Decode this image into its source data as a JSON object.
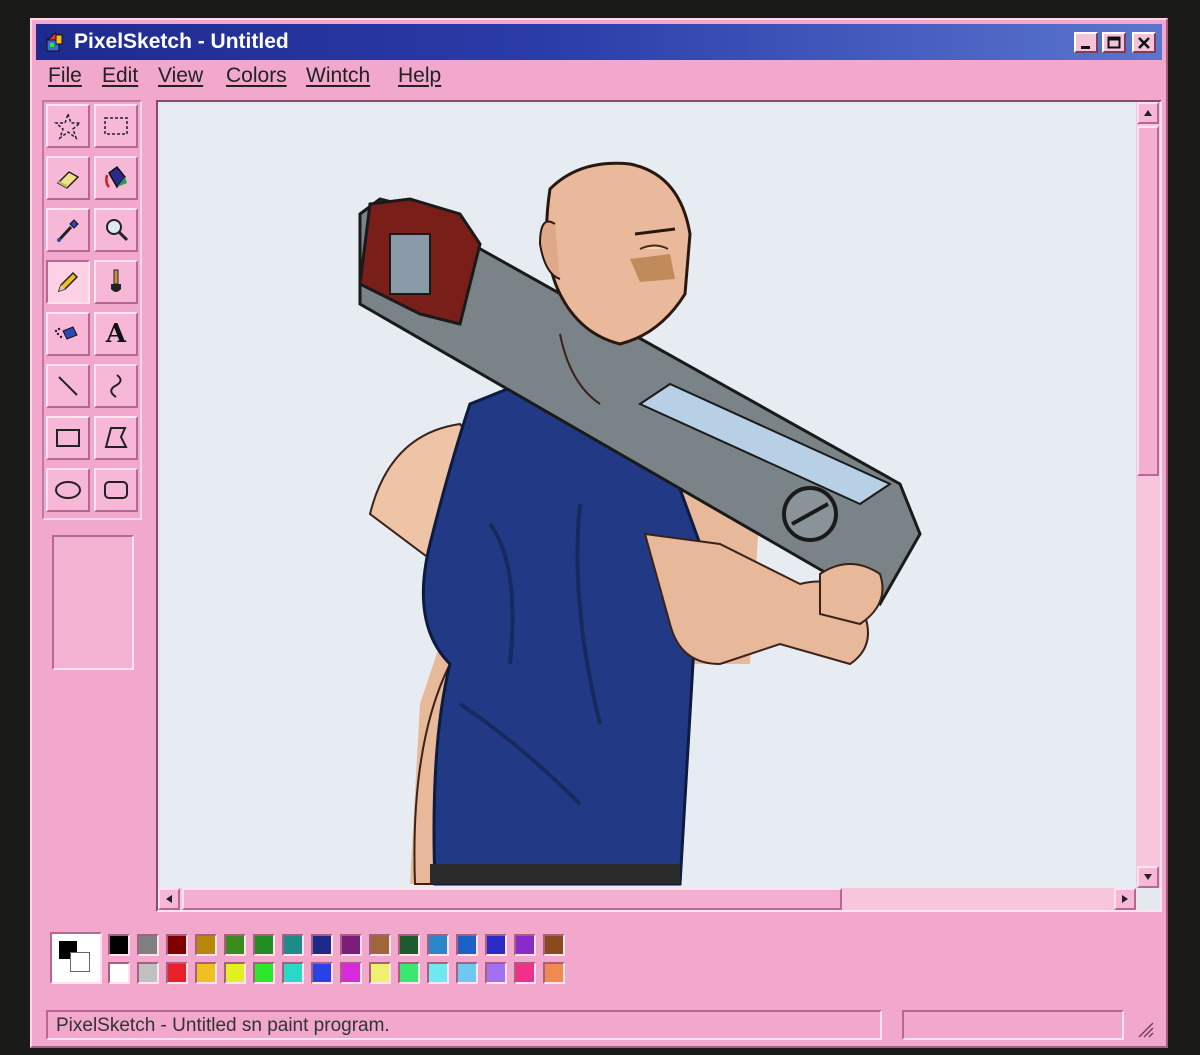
{
  "window": {
    "title": "PixelSketch - Untitled"
  },
  "menu": [
    "File",
    "Edit",
    "View",
    "Colors",
    "Wintch",
    "Help"
  ],
  "tools": [
    {
      "name": "free-select-tool",
      "icon": "star-select-icon"
    },
    {
      "name": "rect-select-tool",
      "icon": "rect-select-icon"
    },
    {
      "name": "eraser-tool",
      "icon": "eraser-icon"
    },
    {
      "name": "fill-tool",
      "icon": "paint-bucket-icon"
    },
    {
      "name": "color-picker-tool",
      "icon": "eyedropper-icon"
    },
    {
      "name": "magnifier-tool",
      "icon": "magnifier-icon"
    },
    {
      "name": "pencil-tool",
      "icon": "pencil-icon",
      "pressed": true
    },
    {
      "name": "brush-tool",
      "icon": "brush-icon"
    },
    {
      "name": "airbrush-tool",
      "icon": "airbrush-icon"
    },
    {
      "name": "text-tool",
      "icon": "text-icon",
      "label": "A"
    },
    {
      "name": "line-tool",
      "icon": "line-icon"
    },
    {
      "name": "curve-tool",
      "icon": "curve-icon"
    },
    {
      "name": "rectangle-tool",
      "icon": "rectangle-icon"
    },
    {
      "name": "polygon-tool",
      "icon": "polygon-icon"
    },
    {
      "name": "ellipse-tool",
      "icon": "ellipse-icon"
    },
    {
      "name": "rounded-rect-tool",
      "icon": "rounded-rect-icon"
    }
  ],
  "palette": {
    "foreground": "#000000",
    "background": "#ffffff",
    "row1": [
      "#000000",
      "#808080",
      "#800000",
      "#b8860b",
      "#3a8a1e",
      "#228b22",
      "#1e8a8a",
      "#1e2a8a",
      "#7a1e7a",
      "#a0663a",
      "#1e5a2e",
      "#2a86c8",
      "#1e60c8",
      "#2a2ac8",
      "#8a2ac8",
      "#8a4a1e"
    ],
    "row2": [
      "#ffffff",
      "#c0c0c0",
      "#e8202a",
      "#f0c020",
      "#e0f020",
      "#2ae82a",
      "#2ad8c8",
      "#2a40e8",
      "#d82ad8",
      "#f0f070",
      "#3ae870",
      "#70e8f0",
      "#70c8f0",
      "#a070f0",
      "#f0308a",
      "#f08a50"
    ]
  },
  "status": {
    "text": "PixelSketch - Untitled sn paint program."
  }
}
